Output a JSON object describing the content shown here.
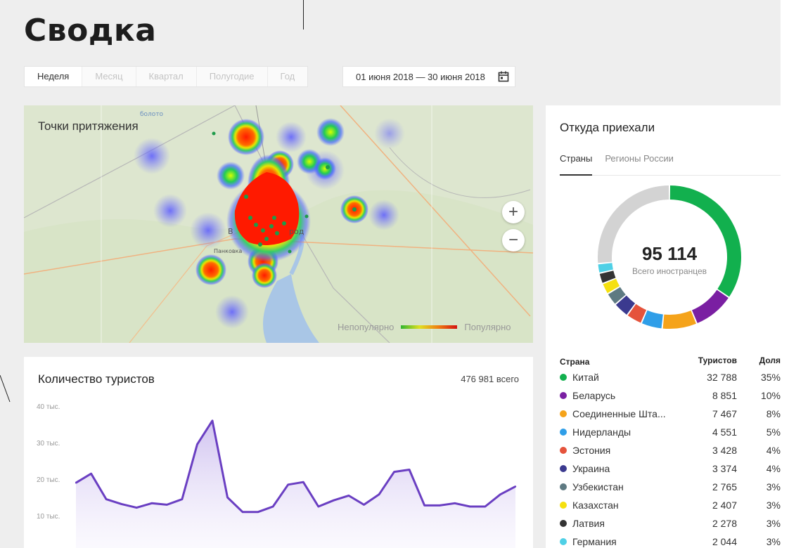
{
  "page": {
    "title": "Сводка"
  },
  "period_tabs": [
    "Неделя",
    "Месяц",
    "Квартал",
    "Полугодие",
    "Год"
  ],
  "date_range": {
    "value": "01 июня 2018 — 30 июня 2018"
  },
  "map": {
    "title": "Точки притяжения",
    "legend_low": "Непопулярно",
    "legend_high": "Популярно",
    "zoom_in": "+",
    "zoom_out": "−"
  },
  "tourists": {
    "title": "Количество туристов",
    "total": "476 981 всего"
  },
  "origin": {
    "title": "Откуда приехали",
    "tabs": [
      "Страны",
      "Регионы России"
    ],
    "total_value": "95 114",
    "total_label": "Всего иностранцев",
    "table_headers": {
      "country": "Страна",
      "tourists": "Туристов",
      "share": "Доля"
    },
    "rows": [
      {
        "country": "Китай",
        "tourists": "32 788",
        "share": "35%",
        "color": "#12b04e"
      },
      {
        "country": "Беларусь",
        "tourists": "8 851",
        "share": "10%",
        "color": "#7a1fa2"
      },
      {
        "country": "Соединенные Шта...",
        "tourists": "7 467",
        "share": "8%",
        "color": "#f5a31a"
      },
      {
        "country": "Нидерланды",
        "tourists": "4 551",
        "share": "5%",
        "color": "#2f9ee8"
      },
      {
        "country": "Эстония",
        "tourists": "3 428",
        "share": "4%",
        "color": "#e5533c"
      },
      {
        "country": "Украина",
        "tourists": "3 374",
        "share": "4%",
        "color": "#3b3a8f"
      },
      {
        "country": "Узбекистан",
        "tourists": "2 765",
        "share": "3%",
        "color": "#5e7a82"
      },
      {
        "country": "Казахстан",
        "tourists": "2 407",
        "share": "3%",
        "color": "#f5e00f"
      },
      {
        "country": "Латвия",
        "tourists": "2 278",
        "share": "3%",
        "color": "#333333"
      },
      {
        "country": "Германия",
        "tourists": "2 044",
        "share": "3%",
        "color": "#4fd0e6"
      }
    ],
    "other_color": "#d3d3d3"
  },
  "chart_data": {
    "type": "area",
    "yticks": [
      "40 тыс.",
      "30 тыс.",
      "20 тыс.",
      "10 тыс."
    ],
    "ylim": [
      0,
      40000
    ],
    "series": [
      {
        "values": [
          19000,
          21500,
          14500,
          13200,
          12200,
          13400,
          13000,
          14500,
          29500,
          36000,
          15000,
          11000,
          11000,
          12500,
          18500,
          19200,
          12500,
          14200,
          15500,
          13000,
          15800,
          22000,
          22600,
          12800,
          12800,
          13400,
          12500,
          12500,
          15800,
          18000
        ]
      }
    ]
  }
}
